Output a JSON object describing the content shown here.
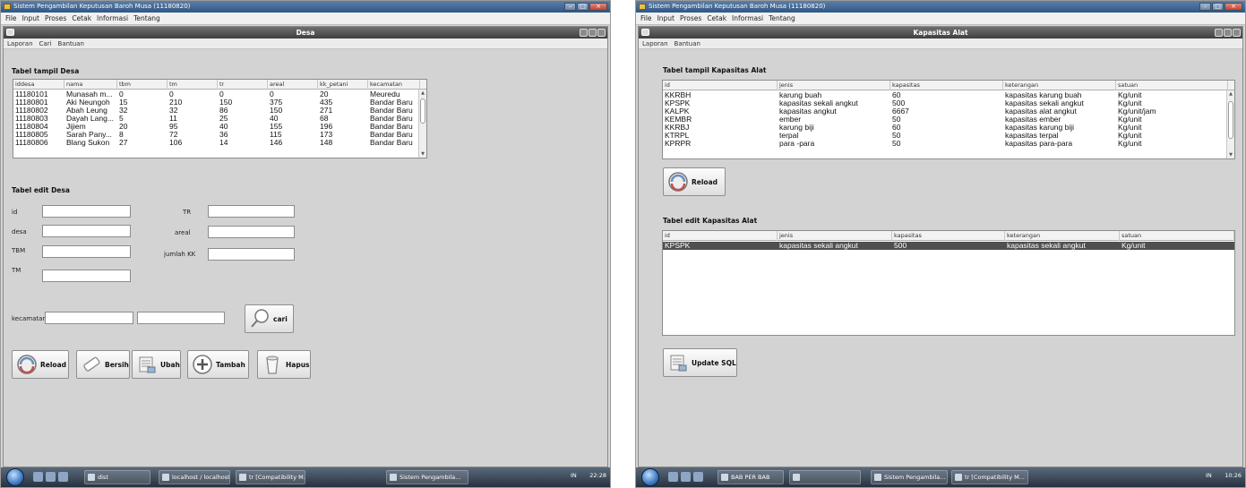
{
  "left": {
    "app_title": "Sistem Pengambilan Keputusan Baroh Musa (11180820)",
    "menu": [
      "File",
      "Input",
      "Proses",
      "Cetak",
      "Informasi",
      "Tentang"
    ],
    "frame_title": "Desa",
    "frame_menu": [
      "Laporan",
      "Cari",
      "Bantuan"
    ],
    "table_view_label": "Tabel tampil Desa",
    "columns": [
      "iddesa",
      "nama",
      "tbm",
      "tm",
      "tr",
      "areal",
      "kk_petani",
      "kecamatan"
    ],
    "rows": [
      [
        "11180101",
        "Munasah m...",
        "0",
        "0",
        "0",
        "0",
        "20",
        "Meuredu"
      ],
      [
        "11180801",
        "Aki Neungoh",
        "15",
        "210",
        "150",
        "375",
        "435",
        "Bandar Baru"
      ],
      [
        "11180802",
        "Abah Leung",
        "32",
        "32",
        "86",
        "150",
        "271",
        "Bandar Baru"
      ],
      [
        "11180803",
        "Dayah Lang...",
        "5",
        "11",
        "25",
        "40",
        "68",
        "Bandar Baru"
      ],
      [
        "11180804",
        "Jijiem",
        "20",
        "95",
        "40",
        "155",
        "196",
        "Bandar Baru"
      ],
      [
        "11180805",
        "Sarah Pany...",
        "8",
        "72",
        "36",
        "115",
        "173",
        "Bandar Baru"
      ],
      [
        "11180806",
        "Blang Sukon",
        "27",
        "106",
        "14",
        "146",
        "148",
        "Bandar Baru"
      ]
    ],
    "edit_label": "Tabel edit Desa",
    "form": {
      "id_label": "id",
      "desa_label": "desa",
      "tbm_label": "TBM",
      "tm_label": "TM",
      "tr_label": "TR",
      "areal_label": "areal",
      "jumlah_kk_label": "jumlah KK",
      "kecamatan_label": "kecamatan"
    },
    "buttons": {
      "cari": "cari",
      "reload": "Reload",
      "bersih": "Bersih",
      "ubah": "Ubah",
      "tambah": "Tambah",
      "hapus": "Hapus"
    },
    "taskbar": {
      "tasks": [
        "dist",
        "localhost / localhost...",
        "tr [Compatibility M...",
        "Sistem Pengambila..."
      ],
      "tray": "IN",
      "clock": "22:28"
    }
  },
  "right": {
    "app_title": "Sistem Pengambilan Keputusan Baroh Musa (11180820)",
    "menu": [
      "File",
      "Input",
      "Proses",
      "Cetak",
      "Informasi",
      "Tentang"
    ],
    "frame_title": "Kapasitas Alat",
    "frame_menu": [
      "Laporan",
      "Bantuan"
    ],
    "table_view_label": "Tabel tampil Kapasitas Alat",
    "columns": [
      "id",
      "jenis",
      "kapasitas",
      "keterangan",
      "satuan"
    ],
    "rows": [
      [
        "KKRBH",
        "karung buah",
        "60",
        "kapasitas karung buah",
        "Kg/unit"
      ],
      [
        "KPSPK",
        "kapasitas sekali angkut",
        "500",
        "kapasitas sekali angkut",
        "Kg/unit"
      ],
      [
        "KALPK",
        "kapasitas angkut",
        "6667",
        "kapasitas alat angkut",
        "Kg/unit/jam"
      ],
      [
        "KEMBR",
        "ember",
        "50",
        "kapasitas ember",
        "Kg/unit"
      ],
      [
        "KKRBJ",
        "karung biji",
        "60",
        "kapasitas karung biji",
        "Kg/unit"
      ],
      [
        "KTRPL",
        "terpal",
        "50",
        "kapasitas terpal",
        "Kg/unit"
      ],
      [
        "KPRPR",
        "para -para",
        "50",
        "kapasitas para-para",
        "Kg/unit"
      ]
    ],
    "reload_label": "Reload",
    "edit_label": "Tabel edit Kapasitas Alat",
    "edit_columns": [
      "id",
      "jenis",
      "kapasitas",
      "keterangan",
      "satuan"
    ],
    "edit_rows": [
      [
        "KPSPK",
        "kapasitas sekali angkut",
        "500",
        "kapasitas sekali angkut",
        "Kg/unit"
      ]
    ],
    "update_label": "Update SQL",
    "taskbar": {
      "tasks": [
        "BAB PER BAB",
        "",
        "Sistem Pengambila...",
        "tr [Compatibility M..."
      ],
      "tray": "IN",
      "clock": "10:26"
    }
  }
}
